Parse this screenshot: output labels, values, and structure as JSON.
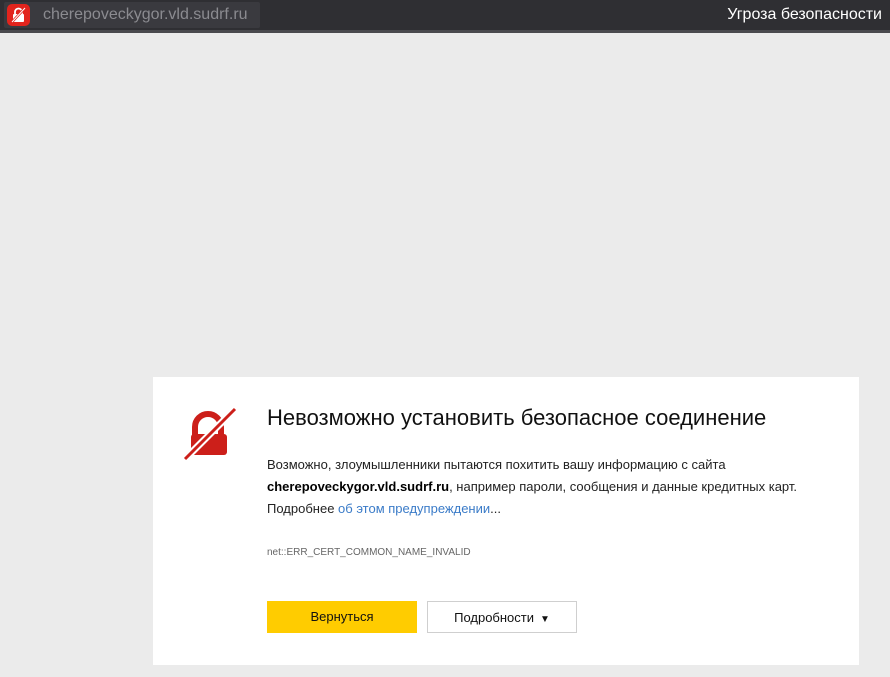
{
  "tab": {
    "url": "cherepoveckygor.vld.sudrf.ru",
    "threat_label": "Угроза безопасности",
    "shield_icon": "broken-lock-icon"
  },
  "colors": {
    "topbar": "#2f2f33",
    "danger": "#e2241d",
    "primary_button": "#ffcc00",
    "link": "#3a7bc8",
    "page_background": "#ebebeb"
  },
  "warning": {
    "icon": "broken-padlock-icon",
    "title": "Невозможно установить безопасное соединение",
    "desc_part1": "Возможно, злоумышленники пытаются похитить вашу информацию с сайта ",
    "site": "cherepoveckygor.vld.sudrf.ru",
    "desc_part2": ", например пароли, сообщения и данные кредитных карт. Подробнее ",
    "link_text": "об этом предупреждении",
    "ellipsis": "...",
    "error_code": "net::ERR_CERT_COMMON_NAME_INVALID",
    "back_button": "Вернуться",
    "details_button": "Подробности",
    "details_caret": "▼"
  }
}
